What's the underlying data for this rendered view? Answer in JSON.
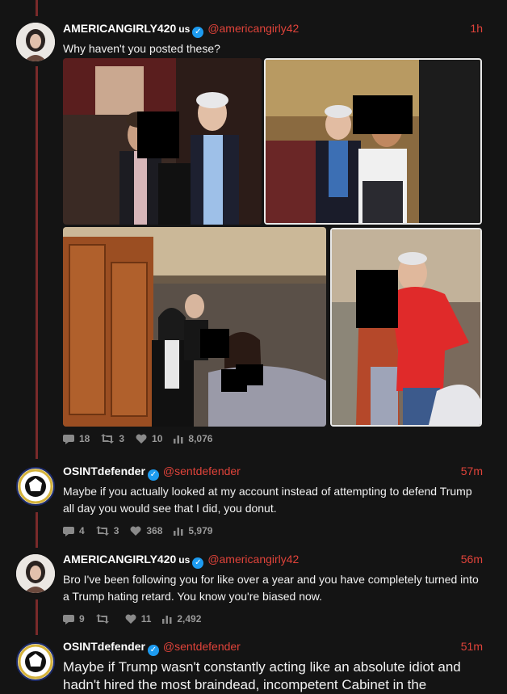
{
  "tweets": [
    {
      "name": "AMERICANGIRLY420",
      "country": "us",
      "handle": "@americangirly42",
      "time": "1h",
      "text": "Why haven't you posted these?",
      "replies": "18",
      "retweets": "3",
      "likes": "10",
      "views": "8,076"
    },
    {
      "name": "OSINTdefender",
      "handle": "@sentdefender",
      "time": "57m",
      "text": "Maybe if you actually looked at my account instead of attempting to defend Trump all day you would see that I did, you donut.",
      "replies": "4",
      "retweets": "3",
      "likes": "368",
      "views": "5,979"
    },
    {
      "name": "AMERICANGIRLY420",
      "country": "us",
      "handle": "@americangirly42",
      "time": "56m",
      "text": "Bro I've been following you for like over a year and you have completely turned into a Trump hating retard. You know you're biased now.",
      "replies": "9",
      "retweets": "",
      "likes": "11",
      "views": "2,492"
    },
    {
      "name": "OSINTdefender",
      "handle": "@sentdefender",
      "time": "51m",
      "text": "Maybe if Trump wasn't constantly acting like an absolute idiot and hadn't hired the most braindead, incompetent Cabinet in the"
    }
  ],
  "colors": {
    "accent": "#e0433a",
    "verified": "#1d9bf0",
    "thread": "#7a2a2a"
  }
}
